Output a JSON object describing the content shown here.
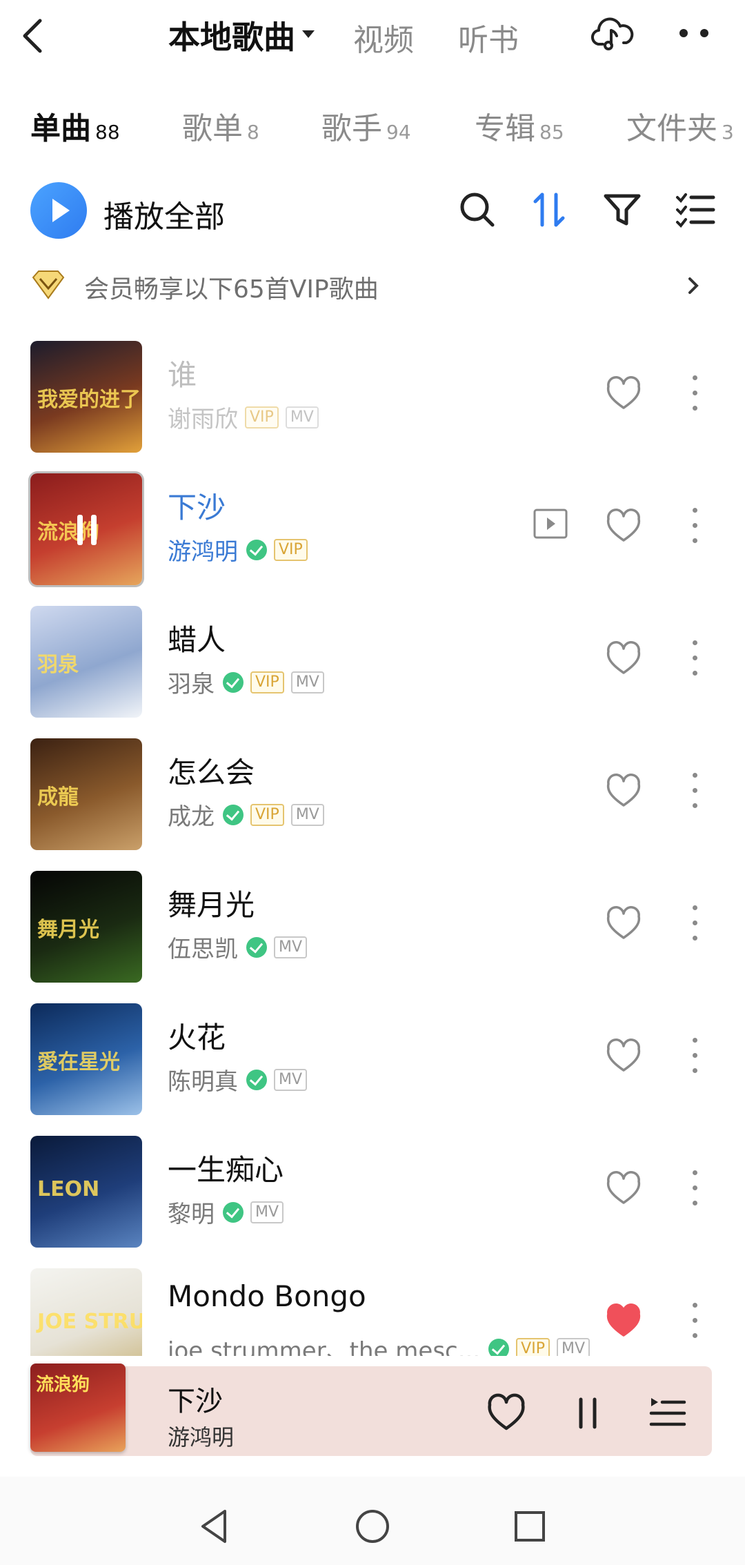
{
  "header": {
    "title": "本地歌曲",
    "tabs": [
      "视频",
      "听书"
    ]
  },
  "subtabs": [
    {
      "label": "单曲",
      "count": "88"
    },
    {
      "label": "歌单",
      "count": "8"
    },
    {
      "label": "歌手",
      "count": "94"
    },
    {
      "label": "专辑",
      "count": "85"
    },
    {
      "label": "文件夹",
      "count": "3"
    }
  ],
  "actions": {
    "play_all": "播放全部",
    "icons": [
      "search-icon",
      "sort-icon",
      "filter-icon",
      "multi-select-icon"
    ]
  },
  "vip_banner": {
    "text": "会员畅享以下65首VIP歌曲"
  },
  "songs": [
    {
      "title": "谁",
      "artist": "谢雨欣",
      "verified": false,
      "tags": [
        "VIP",
        "MV"
      ],
      "liked": false,
      "state": "unavailable",
      "cover_colors": [
        "#1c1c2c",
        "#7a3a20",
        "#e2a13a"
      ],
      "cover_text": "我爱的进了"
    },
    {
      "title": "下沙",
      "artist": "游鸿明",
      "verified": true,
      "tags": [
        "VIP"
      ],
      "liked": false,
      "state": "playing",
      "cover_colors": [
        "#8a1c1c",
        "#c53f2f",
        "#e6a65c"
      ],
      "cover_text": "流浪狗"
    },
    {
      "title": "蜡人",
      "artist": "羽泉",
      "verified": true,
      "tags": [
        "VIP",
        "MV"
      ],
      "liked": false,
      "state": "normal",
      "cover_colors": [
        "#cfd9ef",
        "#8fa7cf",
        "#f1f4f8"
      ],
      "cover_text": "羽泉"
    },
    {
      "title": "怎么会",
      "artist": "成龙",
      "verified": true,
      "tags": [
        "VIP",
        "MV"
      ],
      "liked": false,
      "state": "normal",
      "cover_colors": [
        "#3b2112",
        "#8a5a2c",
        "#caa06a"
      ],
      "cover_text": "成龍"
    },
    {
      "title": "舞月光",
      "artist": "伍思凯",
      "verified": true,
      "tags": [
        "MV"
      ],
      "liked": false,
      "state": "normal",
      "cover_colors": [
        "#050505",
        "#1a2a12",
        "#3a6a22"
      ],
      "cover_text": "舞月光"
    },
    {
      "title": "火花",
      "artist": "陈明真",
      "verified": true,
      "tags": [
        "MV"
      ],
      "liked": false,
      "state": "normal",
      "cover_colors": [
        "#0c2a5a",
        "#2c62a8",
        "#9cc1e8"
      ],
      "cover_text": "愛在星光"
    },
    {
      "title": "一生痴心",
      "artist": "黎明",
      "verified": true,
      "tags": [
        "MV"
      ],
      "liked": false,
      "state": "normal",
      "cover_colors": [
        "#0a1a3a",
        "#1f3e7a",
        "#5a84c0"
      ],
      "cover_text": "LEON"
    },
    {
      "title": "Mondo Bongo",
      "artist": "joe strummer、the mesc...",
      "verified": true,
      "tags": [
        "VIP",
        "MV"
      ],
      "liked": true,
      "state": "normal",
      "cover_colors": [
        "#f4f4f0",
        "#e6e2d6",
        "#c9b47a"
      ],
      "cover_text": "JOE STRUMMER"
    }
  ],
  "mini_player": {
    "title": "下沙",
    "artist": "游鸿明"
  },
  "colors": {
    "accent": "#2f7cf0",
    "playing_text": "#3a7ad4",
    "verified": "#3fc583",
    "vip": "#d9a536",
    "liked": "#f0505a",
    "mini_bg": "#f2dfdb"
  }
}
